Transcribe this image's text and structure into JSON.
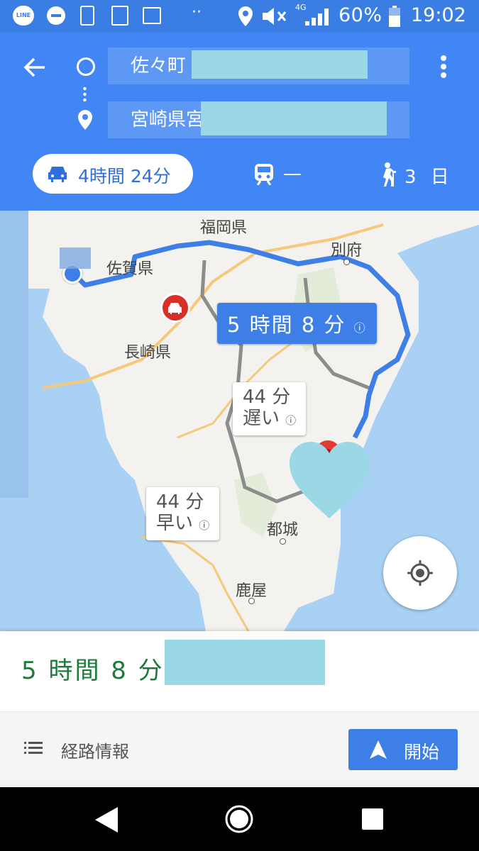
{
  "status_bar": {
    "battery_percent": "60%",
    "time": "19:02",
    "network": "4G",
    "icons": [
      "line-icon",
      "dnd-icon",
      "save-icon",
      "contacts-icon",
      "gallery-icon",
      "location-icon",
      "mute-icon",
      "signal-icon",
      "battery-icon"
    ]
  },
  "header": {
    "origin": "佐々町",
    "destination": "宮崎県宮",
    "modes": {
      "car": "4時間 24分",
      "transit": "—",
      "walk": "3 日"
    }
  },
  "map": {
    "labels": {
      "fukuoka": "福岡県",
      "saga": "佐賀県",
      "beppu": "別府",
      "nagasaki": "長崎県",
      "miyakonojo": "都城",
      "kanoya": "鹿屋"
    },
    "route_main": "5 時間 8 分",
    "alt_slower": {
      "time": "44 分",
      "note": "遅い"
    },
    "alt_faster": {
      "time": "44 分",
      "note": "早い"
    }
  },
  "card": {
    "duration": "5 時間 8 分",
    "steps_label": "経路情報",
    "start_label": "開始"
  },
  "colors": {
    "header_blue": "#4285f4",
    "route_blue": "#3d7fe6",
    "duration_green": "#1e7a3c"
  }
}
